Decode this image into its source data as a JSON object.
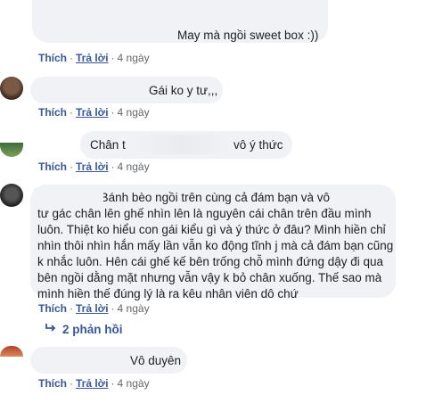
{
  "comments": [
    {
      "text": "May mà ngồi sweet box :))",
      "actions": {
        "like": "Thích",
        "reply": "Trả lời",
        "time": "4 ngày"
      }
    },
    {
      "text": "Gái ko y tư,,,",
      "actions": {
        "like": "Thích",
        "reply": "Trả lời",
        "time": "4 ngày"
      }
    },
    {
      "text_start": "Chân t",
      "text_end": "vô ý thức",
      "actions": {
        "like": "Thích",
        "reply": "Trả lời",
        "time": "4 ngày"
      }
    },
    {
      "text": "Đã từng bị. Bánh bèo ngồi trên cùng cả đám bạn và vô\ntư gác chân lên ghế nhìn lên là nguyên cái chân trên đầu mình\nluôn. Thiệt ko hiểu con gái kiểu gì và ý thức ở đâu? Mình hiền chỉ\nnhìn thôi nhìn hắn mấy lần vẫn ko động tĩnh j mà cả đám bạn cũng\nk nhắc luôn. Hên cái ghế kế bên trống chỗ mình đứng dậy đi qua\nbên ngồi dằng mặt nhưng vẫn vậy k bỏ chân xuống. Thế sao mà\nmình hiền thế đúng lý là ra kêu nhân viên dô chứ",
      "actions": {
        "like": "Thích",
        "reply": "Trả lời",
        "time": "4 ngày"
      },
      "replies_label": "2 phản hồi"
    },
    {
      "text": "Vô duyên",
      "actions": {
        "like": "Thích",
        "reply": "Trả lời",
        "time": "4 ngày"
      }
    }
  ],
  "colors": {
    "bubble": "#f0f2f5",
    "link": "#385898",
    "meta": "#65676b"
  }
}
